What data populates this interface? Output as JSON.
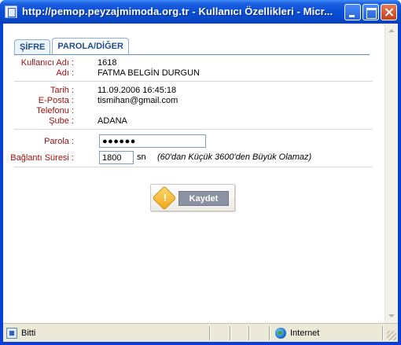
{
  "window": {
    "title": "http://pemop.peyzajmimoda.org.tr - Kullanıcı Özellikleri - Micr..."
  },
  "tabs": [
    {
      "label": "ŞİFRE",
      "active": false
    },
    {
      "label": "PAROLA/DİĞER",
      "active": true
    }
  ],
  "user": {
    "username_label": "Kullanıcı Adı :",
    "username": "1618",
    "name_label": "Adı :",
    "name": "FATMA BELGİN DURGUN",
    "date_label": "Tarih :",
    "date": "11.09.2006 16:45:18",
    "email_label": "E-Posta :",
    "email": "tismihan@gmail.com",
    "phone_label": "Telefonu :",
    "phone": "",
    "branch_label": "Şube :",
    "branch": "ADANA"
  },
  "form": {
    "password_label": "Parola :",
    "password_value": "●●●●●●",
    "duration_label": "Bağlantı Süresi :",
    "duration_value": "1800",
    "duration_unit": "sn",
    "duration_hint": "(60'dan Küçük 3600'den Büyük Olamaz)",
    "save_label": "Kaydet"
  },
  "statusbar": {
    "status": "Bitti",
    "zone": "Internet"
  },
  "icons": {
    "app": "page-icon",
    "save": "warning-icon",
    "status": "page-icon",
    "zone": "globe-icon"
  },
  "colors": {
    "label": "#a01010",
    "tab_text": "#1f4d8a",
    "titlebar": "#0a4ed6",
    "button_label_bg": "#8b93a3"
  }
}
